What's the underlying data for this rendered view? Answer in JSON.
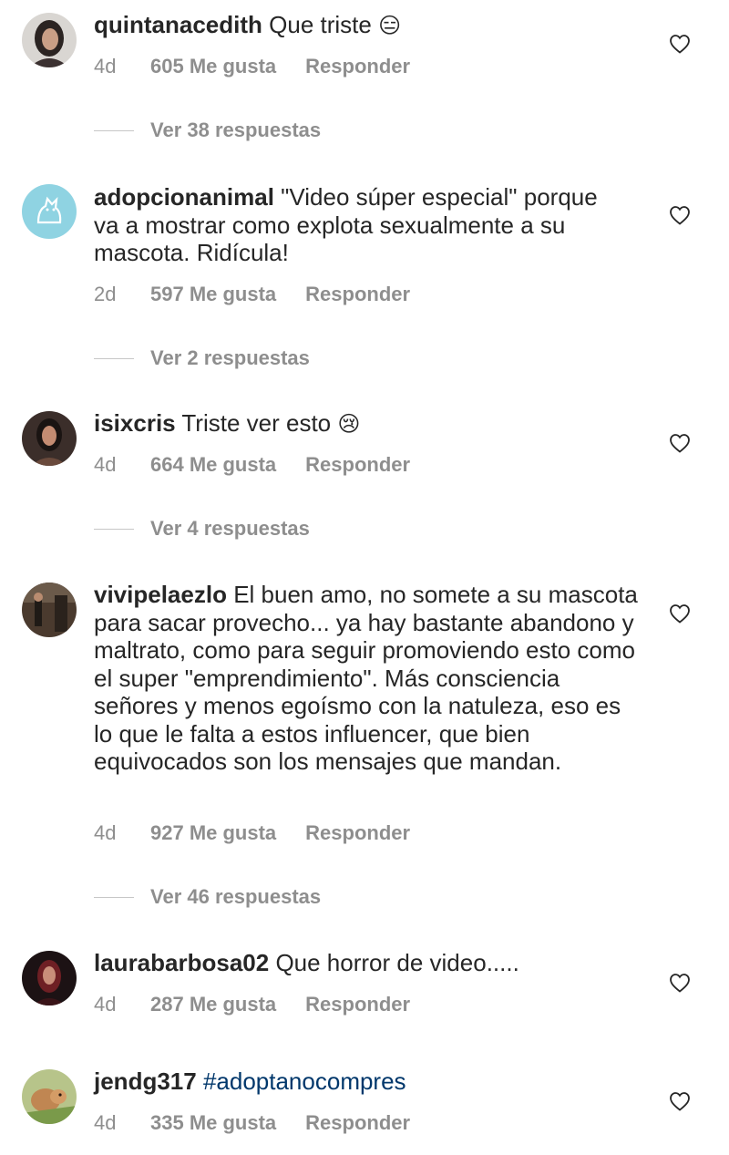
{
  "comments": [
    {
      "username": "quintanacedith",
      "text": " Que triste ",
      "emoji": "😑",
      "time": "4d",
      "likes": "605 Me gusta",
      "reply": "Responder",
      "view_replies": "Ver 38 respuestas"
    },
    {
      "username": "adopcionanimal",
      "text": " \"Video súper especial\" porque va a mostrar como explota sexualmente a su mascota. Ridícula!",
      "time": "2d",
      "likes": "597 Me gusta",
      "reply": "Responder",
      "view_replies": "Ver 2 respuestas"
    },
    {
      "username": "isixcris",
      "text": " Triste ver esto ",
      "emoji": "😢",
      "time": "4d",
      "likes": "664 Me gusta",
      "reply": "Responder",
      "view_replies": "Ver 4 respuestas"
    },
    {
      "username": "vivipelaezlo",
      "text": " El buen amo, no somete a su mascota para sacar provecho... ya hay bastante abandono y maltrato, como para seguir promoviendo esto como el super \"emprendimiento\". Más consciencia señores y menos egoísmo con la natuleza, eso es lo que le falta a estos influencer, que bien equivocados son los mensajes que mandan.",
      "time": "4d",
      "likes": "927 Me gusta",
      "reply": "Responder",
      "view_replies": "Ver 46 respuestas"
    },
    {
      "username": "laurabarbosa02",
      "text": " Que horror de video.....",
      "time": "4d",
      "likes": "287 Me gusta",
      "reply": "Responder"
    },
    {
      "username": "jendg317",
      "hashtag": "#adoptanocompres",
      "time": "4d",
      "likes": "335 Me gusta",
      "reply": "Responder"
    }
  ]
}
